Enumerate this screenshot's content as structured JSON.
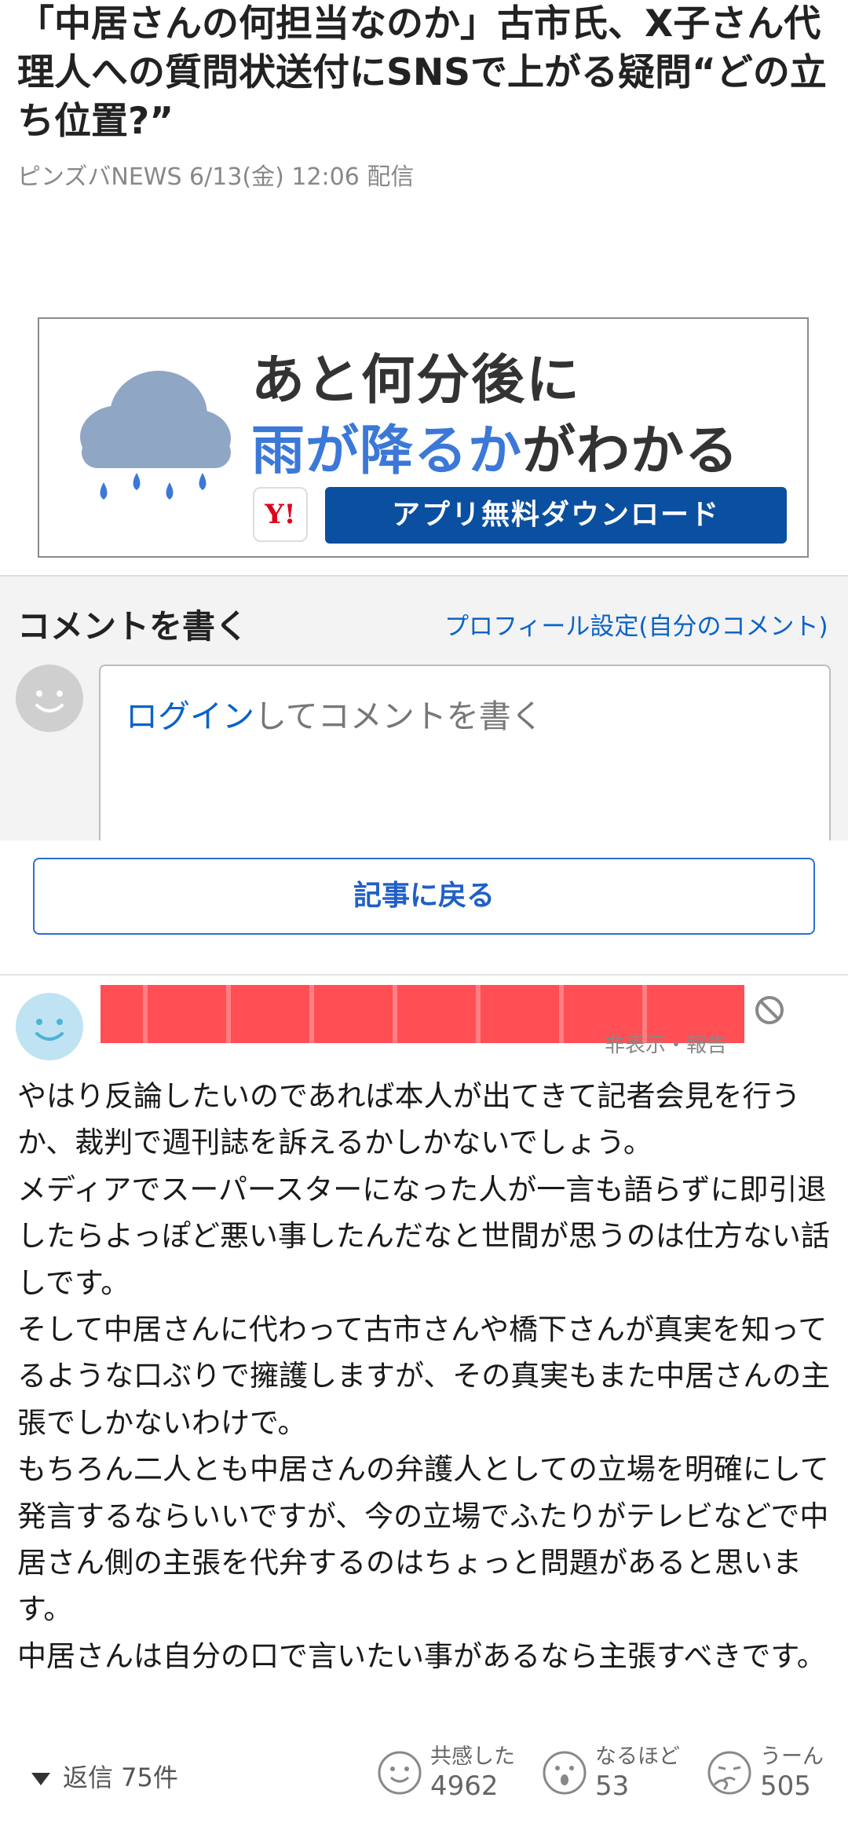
{
  "article": {
    "title": "「中居さんの何担当なのか」古市氏、X子さん代理人への質問状送付にSNSで上がる疑問“どの立ち位置?”",
    "source_meta": "ピンズバNEWS 6/13(金) 12:06 配信"
  },
  "ad": {
    "line1": "あと何分後に",
    "line2_highlight": "雨が降るか",
    "line2_rest": "がわかる",
    "logo_text": "Y!",
    "button_label": "アプリ無料ダウンロード"
  },
  "comment_form": {
    "title": "コメントを書く",
    "profile_link": "プロフィール設定(自分のコメント)",
    "placeholder_link": "ログイン",
    "placeholder_rest": "してコメントを書く"
  },
  "back_button": "記事に戻る",
  "comment": {
    "action_text": "非表示・報告",
    "body": [
      "やはり反論したいのであれば本人が出てきて記者会見を行うか、裁判で週刊誌を訴えるかしかないでしょう。",
      "メディアでスーパースターになった人が一言も語らずに即引退したらよっぽど悪い事したんだなと世間が思うのは仕方ない話しです。",
      "そして中居さんに代わって古市さんや橋下さんが真実を知ってるような口ぶりで擁護しますが、その真実もまた中居さんの主張でしかないわけで。",
      "もちろん二人とも中居さんの弁護人としての立場を明確にして発言するならいいですが、今の立場でふたりがテレビなどで中居さん側の主張を代弁するのはちょっと問題があると思います。",
      "中居さんは自分の口で言いたい事があるなら主張すべきです。"
    ],
    "replies": "返信 75件",
    "reactions": [
      {
        "label": "共感した",
        "count": "4962",
        "icon": "smile-face-icon"
      },
      {
        "label": "なるほど",
        "count": "53",
        "icon": "surprised-face-icon"
      },
      {
        "label": "うーん",
        "count": "505",
        "icon": "thinking-face-icon"
      }
    ]
  }
}
